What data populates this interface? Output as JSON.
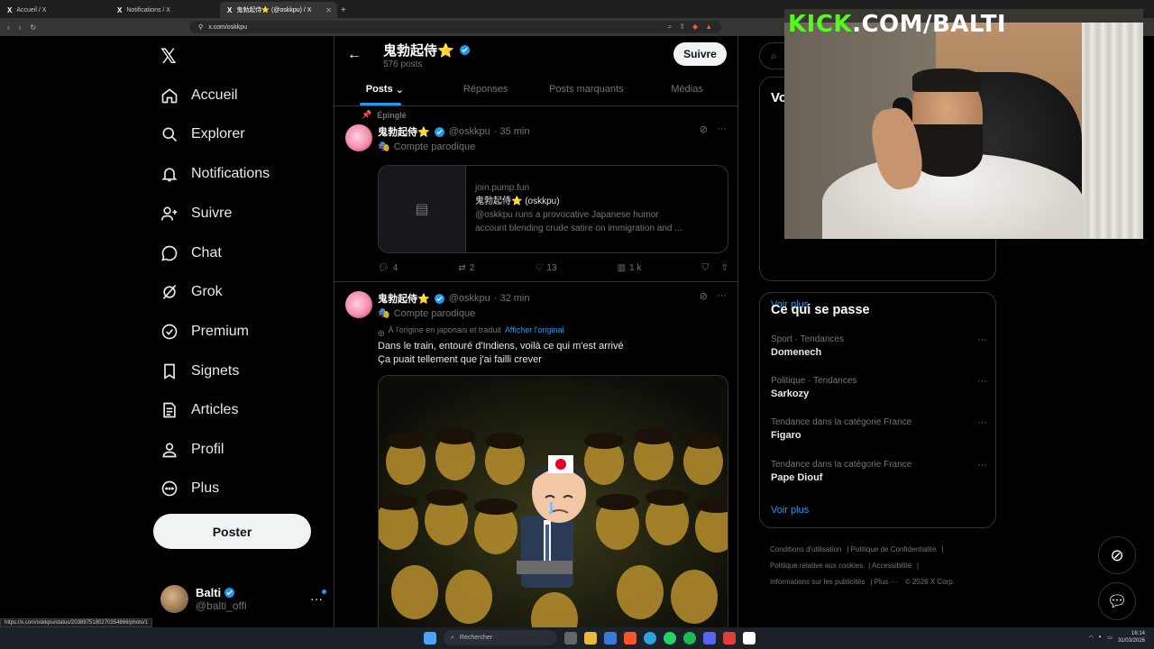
{
  "browser": {
    "tabs": [
      {
        "title": "Accueil / X",
        "active": false
      },
      {
        "title": "Notifications / X",
        "active": false
      },
      {
        "title": "鬼勃起侍⭐ (@oskkpu) / X",
        "active": true
      }
    ],
    "new_tab": "+",
    "url": "x.com/oskkpu",
    "status_url": "https://x.com/oskkpu/status/2038975180270354866/photo/1"
  },
  "nav": {
    "logo": "𝕏",
    "items": [
      {
        "label": "Accueil",
        "icon": "home-icon"
      },
      {
        "label": "Explorer",
        "icon": "search-icon"
      },
      {
        "label": "Notifications",
        "icon": "bell-icon"
      },
      {
        "label": "Suivre",
        "icon": "add-person-icon"
      },
      {
        "label": "Chat",
        "icon": "chat-icon"
      },
      {
        "label": "Grok",
        "icon": "grok-icon"
      },
      {
        "label": "Premium",
        "icon": "premium-icon"
      },
      {
        "label": "Signets",
        "icon": "bookmark-icon"
      },
      {
        "label": "Articles",
        "icon": "article-icon"
      },
      {
        "label": "Profil",
        "icon": "person-icon"
      },
      {
        "label": "Plus",
        "icon": "more-circle-icon"
      }
    ],
    "post_button": "Poster",
    "account": {
      "name": "Balti",
      "handle": "@balti_offi"
    }
  },
  "profile": {
    "name": "鬼勃起侍⭐",
    "post_count": "576 posts",
    "follow_button": "Suivre",
    "tabs": [
      "Posts",
      "Réponses",
      "Posts marquants",
      "Médias"
    ]
  },
  "tweets": [
    {
      "pinned_label": "Épinglé",
      "name": "鬼勃起侍⭐",
      "handle": "@oskkpu",
      "time": "· 35 min",
      "parody": "Compte parodique",
      "card": {
        "domain": "join.pump.fun",
        "title": "鬼勃起侍⭐ (oskkpu)",
        "desc_line1": "@oskkpu runs a provocative Japanese humor",
        "desc_line2": "account blending crude satire on immigration and ..."
      },
      "stats": {
        "replies": "4",
        "reposts": "2",
        "likes": "13",
        "views": "1 k"
      }
    },
    {
      "name": "鬼勃起侍⭐",
      "handle": "@oskkpu",
      "time": "· 32 min",
      "parody": "Compte parodique",
      "translated": "À l'origine en japonais et traduit",
      "show_original": "Afficher l'original",
      "text_line1": "Dans le train, entouré d'Indiens, voilà ce qui m'est arrivé",
      "text_line2": "Ça puait tellement que j'ai failli crever"
    }
  ],
  "right": {
    "who_title": "Vo",
    "who_more": "Voir plus",
    "trends_title": "Ce qui se passe",
    "trends": [
      {
        "category": "Sport · Tendances",
        "name": "Domenech"
      },
      {
        "category": "Politique · Tendances",
        "name": "Sarkozy"
      },
      {
        "category": "Tendance dans la catégorie France",
        "name": "Figaro"
      },
      {
        "category": "Tendance dans la catégorie France",
        "name": "Pape Diouf"
      }
    ],
    "trends_more": "Voir plus",
    "footer": [
      "Conditions d'utilisation",
      "Politique de Confidentialité",
      "Politique relative aux cookies",
      "Accessibilité",
      "Informations sur les publicités",
      "Plus ···",
      "© 2026 X Corp."
    ]
  },
  "overlay": {
    "kick_k": "KICK",
    "kick_rest": ".COM/BALTI"
  },
  "taskbar": {
    "search": "Rechercher",
    "time": "16:14",
    "date": "31/03/2026"
  }
}
